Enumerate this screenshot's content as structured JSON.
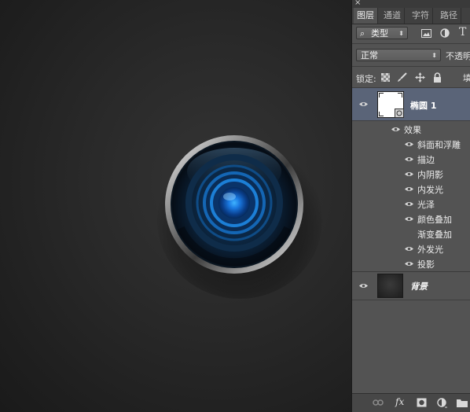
{
  "window": {
    "close_icon": "×"
  },
  "tabs": [
    {
      "label": "图层",
      "active": true
    },
    {
      "label": "通道",
      "active": false
    },
    {
      "label": "字符",
      "active": false
    },
    {
      "label": "路径",
      "active": false
    }
  ],
  "filter": {
    "search_icon": "⌕",
    "kind_label": "类型",
    "icons": [
      "image-filter-icon",
      "adjustment-filter-icon",
      "type-filter-icon"
    ],
    "type_glyph": "T"
  },
  "blend": {
    "mode": "正常",
    "opacity_label": "不透明"
  },
  "lock": {
    "label": "锁定:",
    "fill_label": "填"
  },
  "layers": {
    "shape_layer": {
      "name": "椭圆 1"
    },
    "effects_header": "效果",
    "effects": [
      {
        "label": "斜面和浮雕",
        "visible": true
      },
      {
        "label": "描边",
        "visible": true
      },
      {
        "label": "内阴影",
        "visible": true
      },
      {
        "label": "内发光",
        "visible": true
      },
      {
        "label": "光泽",
        "visible": true
      },
      {
        "label": "颜色叠加",
        "visible": true
      },
      {
        "label": "渐变叠加",
        "visible": false
      },
      {
        "label": "外发光",
        "visible": true
      },
      {
        "label": "投影",
        "visible": true
      }
    ],
    "background_layer": {
      "name": "背景"
    }
  },
  "footer": {
    "fx_label": "fx"
  },
  "colors": {
    "panel_bg": "#535353",
    "selected_layer": "#5a6478",
    "knob_glow": "#1e90ff"
  }
}
